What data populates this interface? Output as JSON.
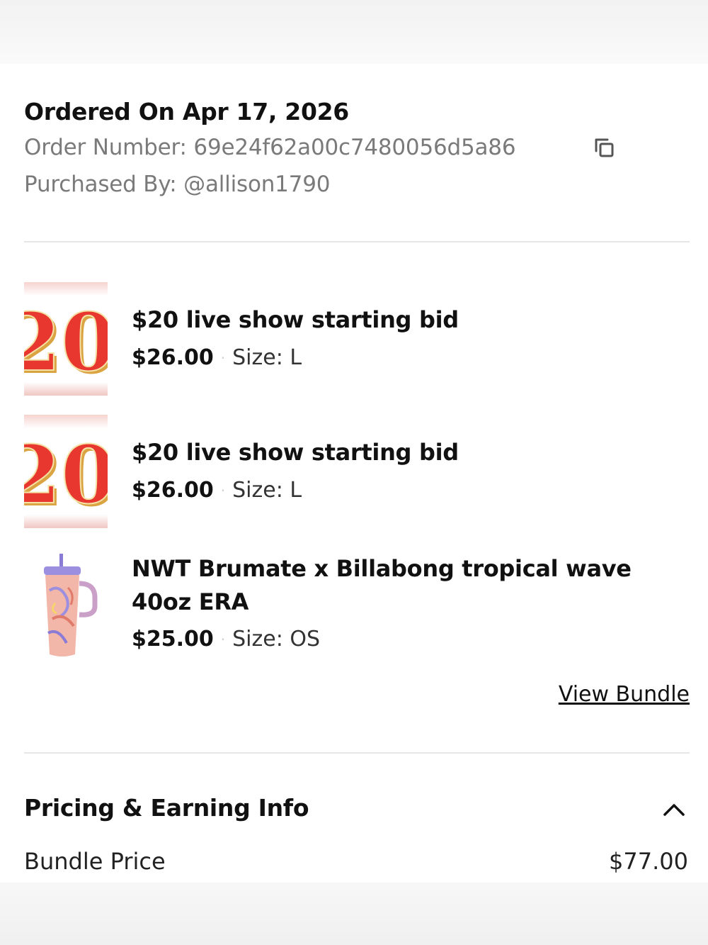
{
  "order": {
    "ordered_on": "Ordered On Apr 17, 2026",
    "order_number": "Order Number: 69e24f62a00c7480056d5a86",
    "purchased_by": "Purchased By:  @allison1790"
  },
  "items": [
    {
      "title": "$20 live show starting bid",
      "price": "$26.00",
      "size": "Size: L",
      "thumb_icon": "20-badge-image"
    },
    {
      "title": "$20 live show starting bid",
      "price": "$26.00",
      "size": "Size: L",
      "thumb_icon": "20-badge-image"
    },
    {
      "title": "NWT Brumate x Billabong tropical wave 40oz ERA",
      "price": "$25.00",
      "size": "Size: OS",
      "thumb_icon": "tumbler-image"
    }
  ],
  "thumb_text": "20",
  "separator": "·",
  "view_bundle_label": "View Bundle",
  "pricing": {
    "section_title": "Pricing & Earning Info",
    "bundle_price_label": "Bundle Price",
    "bundle_price_value": "$77.00"
  },
  "colors": {
    "badge_red": "#e8372f",
    "badge_gold": "#d9a441",
    "text_muted": "#7a7a7a"
  }
}
